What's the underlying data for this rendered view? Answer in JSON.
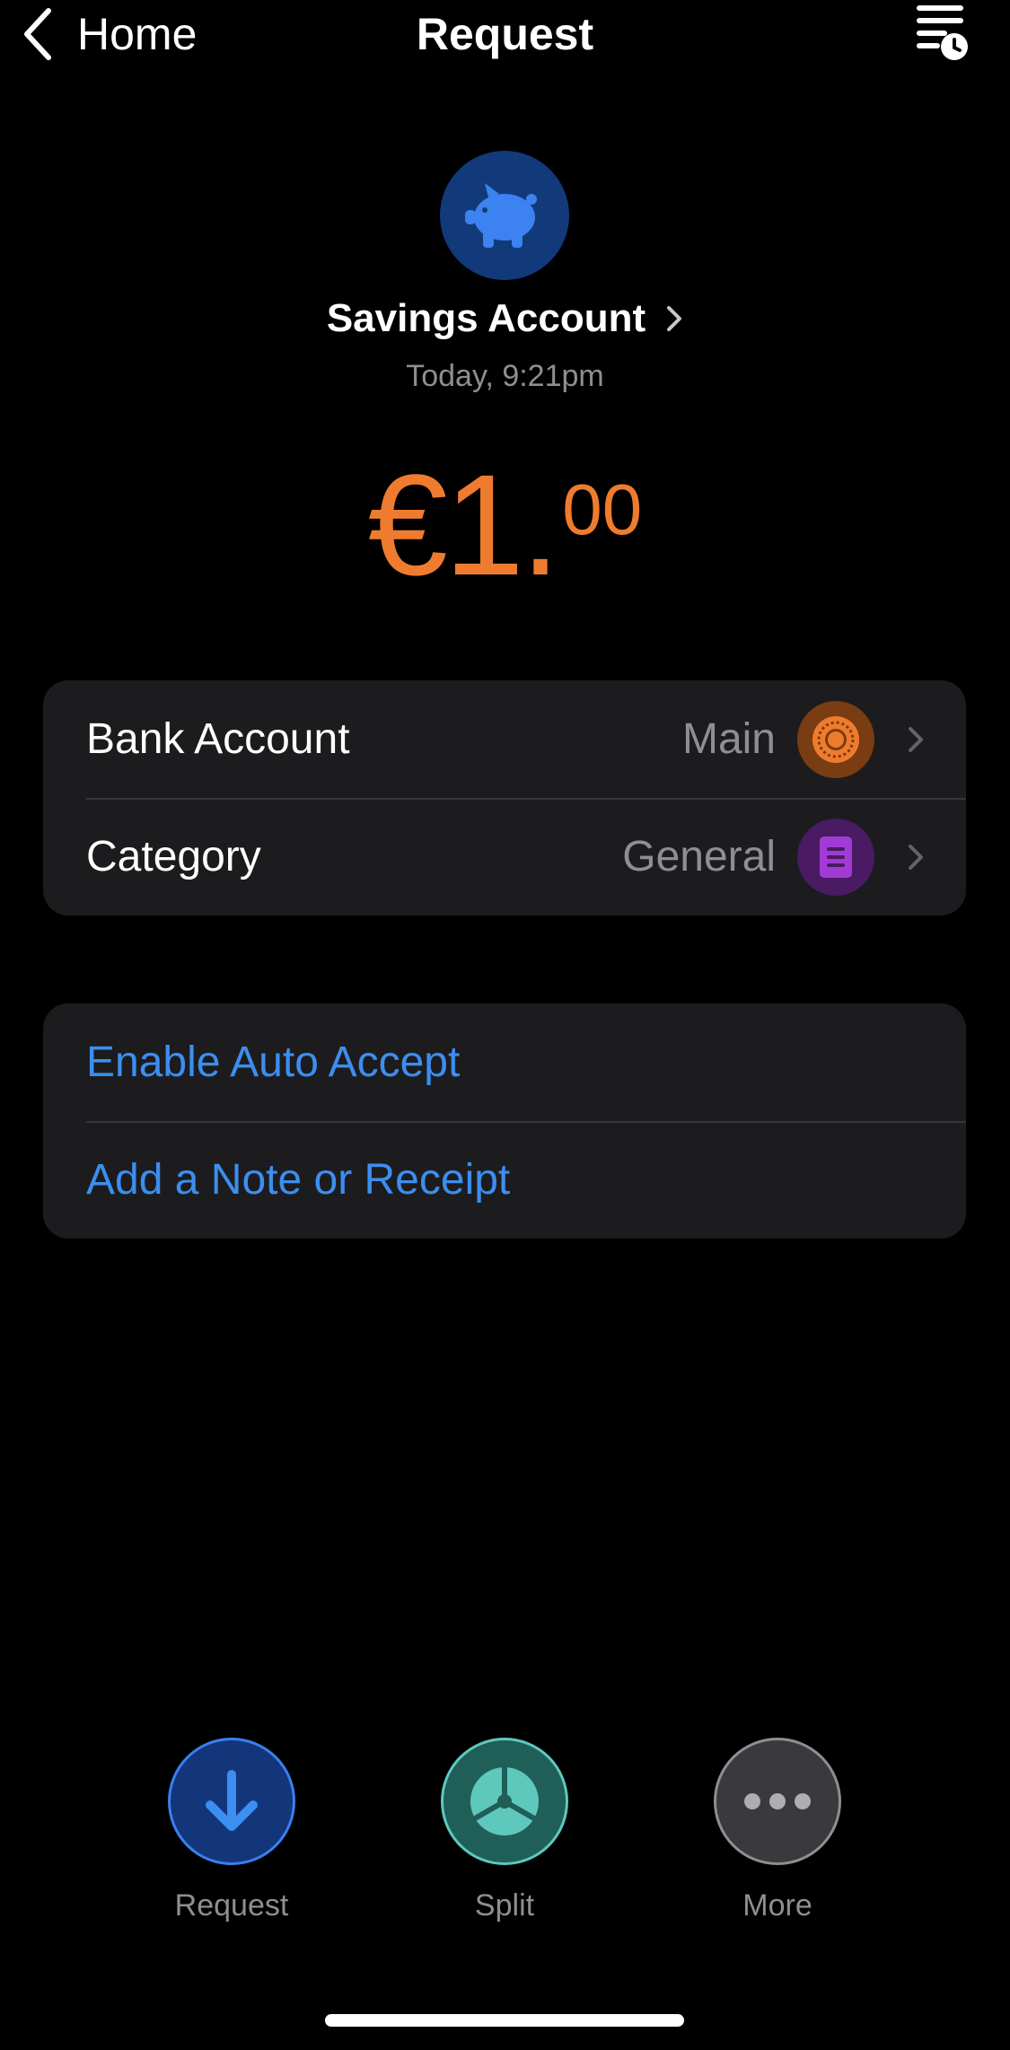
{
  "nav": {
    "back_label": "Home",
    "title": "Request",
    "history_icon": "list-clock-icon"
  },
  "account": {
    "icon": "piggy-bank-icon",
    "name": "Savings Account",
    "date": "Today, 9:21pm"
  },
  "amount": {
    "main": "€1.",
    "decimals": "00"
  },
  "details": {
    "bank_account": {
      "label": "Bank Account",
      "value": "Main",
      "icon": "coin-icon",
      "icon_color": "#ef7c2e"
    },
    "category": {
      "label": "Category",
      "value": "General",
      "icon": "document-icon",
      "icon_color": "#a23bd6"
    }
  },
  "options": {
    "auto_accept": "Enable Auto Accept",
    "note": "Add a Note or Receipt"
  },
  "actions": [
    {
      "label": "Request",
      "icon": "arrow-down-icon"
    },
    {
      "label": "Split",
      "icon": "pie-split-icon"
    },
    {
      "label": "More",
      "icon": "ellipsis-icon"
    }
  ],
  "colors": {
    "accent": "#ef7c2e",
    "link": "#3c8ef0",
    "background": "#000000",
    "card": "#1c1c1e"
  }
}
